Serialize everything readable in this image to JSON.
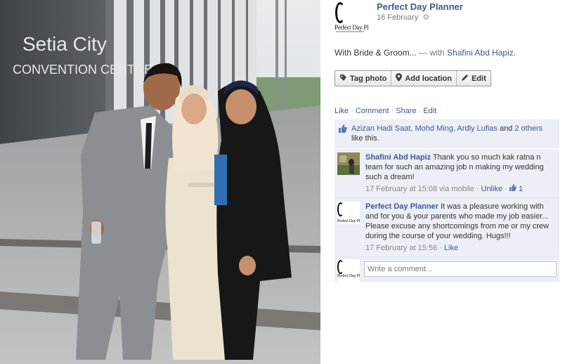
{
  "photo": {
    "sign_line1": "Setia City",
    "sign_line2": "CONVENTION CENTRE"
  },
  "post": {
    "owner_name": "Perfect Day Planner",
    "date": "16 February",
    "logo_text": "Perfect Day Pl",
    "with_prefix": "With Bride & Groom...",
    "with_dash": " — with ",
    "with_name": "Shafini Abd Hapiz",
    "with_suffix": "."
  },
  "actions": {
    "tag_photo": "Tag photo",
    "add_location": "Add location",
    "edit": "Edit"
  },
  "ufi_links": {
    "like": "Like",
    "comment": "Comment",
    "share": "Share",
    "edit": "Edit",
    "separator": "·"
  },
  "likes": {
    "names": "Azizan Hadi Saat, Mohd Ming, Ardly Lufias",
    "and_text": " and ",
    "others": "2 others",
    "suffix": " like this."
  },
  "comments": [
    {
      "author": "Shafini Abd Hapiz",
      "text": "Thank you so much kak ratna n team for such an amazing job n making my wedding such a dream!",
      "time": "17 February at 15:08 via mobile",
      "action": "Unlike",
      "like_count": "1"
    },
    {
      "author": "Perfect Day Planner",
      "text": "It was a pleasure working with and for you & your parents who made my job easier... Please excuse any shortcomings from me or my crew during the course of your wedding. Hugs!!!",
      "time": "17 February at 15:56",
      "action": "Like"
    }
  ],
  "composer": {
    "placeholder": "Write a comment..."
  },
  "colors": {
    "link": "#3b5998",
    "ufi_background": "#eceff5",
    "muted": "#777777"
  },
  "icons": {
    "audience": "gear-icon",
    "tag": "tag-icon",
    "location": "location-pin-icon",
    "edit": "pencil-icon",
    "like": "thumbs-up-icon"
  }
}
